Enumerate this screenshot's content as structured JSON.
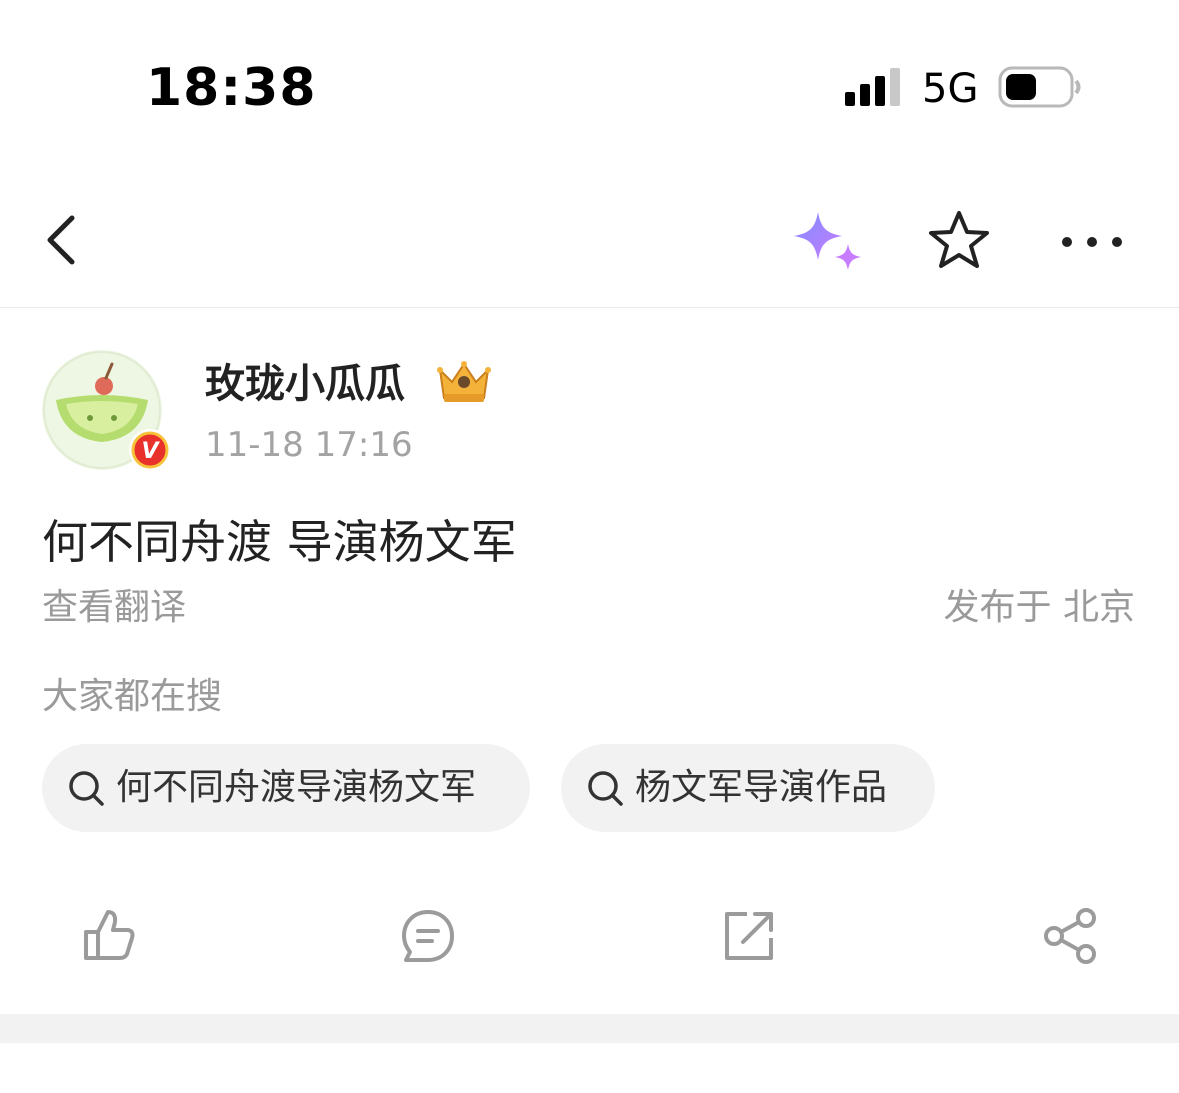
{
  "status_bar": {
    "time": "18:38",
    "network": "5G",
    "icons": [
      "signal-icon",
      "battery-icon"
    ]
  },
  "nav_bar": {
    "icons": [
      "back-icon",
      "sparkle-icon",
      "star-icon",
      "more-icon"
    ],
    "accent_colors": [
      "#8b7bff",
      "#c47dff"
    ]
  },
  "author": {
    "name": "玫珑小瓜瓜",
    "time": "11-18 17:16",
    "badges": [
      "verified-badge",
      "crown-badge"
    ],
    "verified_color": "#e8312a"
  },
  "post": {
    "text": "何不同舟渡 导演杨文军",
    "translate_label": "查看翻译",
    "location": "发布于 北京"
  },
  "trending": {
    "label": "大家都在搜",
    "chips": [
      {
        "label": "何不同舟渡导演杨文军",
        "icon": "search-icon"
      },
      {
        "label": "杨文军导演作品",
        "icon": "search-icon"
      }
    ]
  },
  "actions": {
    "icons": [
      "like-icon",
      "comment-icon",
      "repost-icon",
      "share-icon"
    ],
    "icon_color": "#9b9b9b"
  }
}
